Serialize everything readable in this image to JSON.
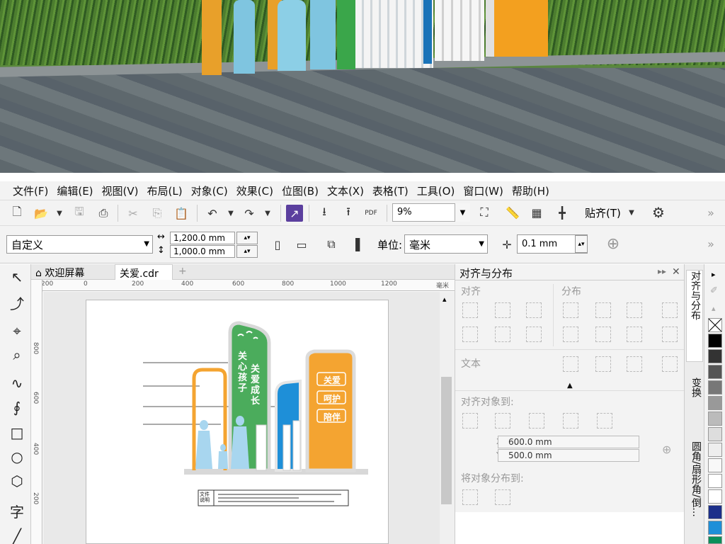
{
  "menubar": {
    "items": [
      "文件(F)",
      "编辑(E)",
      "视图(V)",
      "布局(L)",
      "对象(C)",
      "效果(C)",
      "位图(B)",
      "文本(X)",
      "表格(T)",
      "工具(O)",
      "窗口(W)",
      "帮助(H)"
    ]
  },
  "toolbar1": {
    "zoom": "9%",
    "pdf_label": "PDF",
    "snap_label": "贴齐(T)"
  },
  "propbar": {
    "preset": "自定义",
    "width": "1,200.0 mm",
    "height": "1,000.0 mm",
    "unit_label": "单位:",
    "unit_value": "毫米",
    "nudge": "0.1 mm"
  },
  "doctabs": {
    "welcome": "欢迎屏幕",
    "file": "关爱.cdr",
    "add": "+"
  },
  "ruler": {
    "h_ticks": [
      "200",
      "0",
      "200",
      "400",
      "600",
      "800",
      "1000",
      "1200"
    ],
    "h_unit": "毫米",
    "v_ticks": [
      "800",
      "600",
      "400",
      "200"
    ]
  },
  "artwork": {
    "green_panel_col1": "关心孩子",
    "green_panel_col2": "关爱成长",
    "orange_panel": [
      "关爱",
      "呵护",
      "陪伴"
    ],
    "legend_label": "文件说明"
  },
  "docker": {
    "title": "对齐与分布",
    "sec_align": "对齐",
    "sec_distribute": "分布",
    "sec_text": "文本",
    "sec_align_to": "对齐对象到:",
    "x_label": "X:",
    "x_value": "600.0 mm",
    "y_label": "Y:",
    "y_value": "500.0 mm",
    "sec_distribute_to": "将对象分布到:"
  },
  "sidetabs": [
    "对齐与分布",
    "变换",
    "圆角/扇形角/倒..."
  ],
  "colors": {
    "green": "#4bac5c",
    "blue": "#1e8fd8",
    "orange": "#f4a431",
    "light_blue": "#a8d6ef",
    "accent_purple": "#5b3f9e"
  }
}
